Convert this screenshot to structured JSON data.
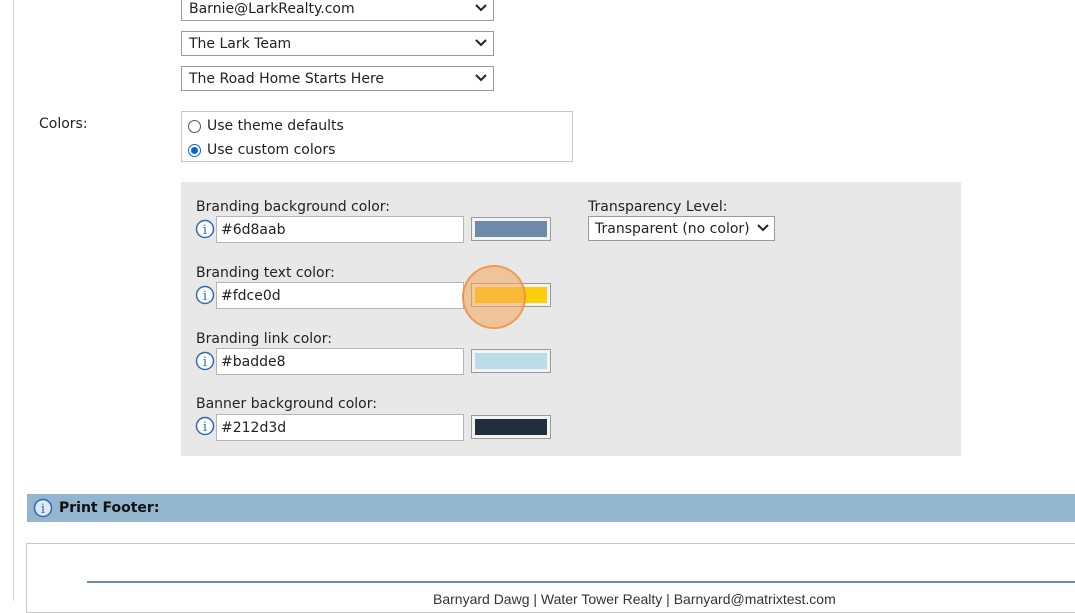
{
  "header_selects": [
    {
      "value": "Barnie@LarkRealty.com"
    },
    {
      "value": "The Lark Team"
    },
    {
      "value": "The Road Home Starts Here"
    }
  ],
  "colors": {
    "label": "Colors:",
    "options": [
      {
        "label": "Use theme defaults",
        "checked": false
      },
      {
        "label": "Use custom colors",
        "checked": true
      }
    ]
  },
  "branding": {
    "fields": [
      {
        "label": "Branding background color:",
        "value": "#6d8aab",
        "swatch": "#6d8aab"
      },
      {
        "label": "Branding text color:",
        "value": "#fdce0d",
        "swatch": "#fdce0d"
      },
      {
        "label": "Branding link color:",
        "value": "#badde8",
        "swatch": "#badde8"
      },
      {
        "label": "Banner background color:",
        "value": "#212d3d",
        "swatch": "#212d3d"
      }
    ],
    "transparency": {
      "label": "Transparency Level:",
      "value": "Transparent (no color)"
    }
  },
  "print_footer": {
    "title": "Print Footer:",
    "preview_text": "Barnyard Dawg | Water Tower Realty | Barnyard@matrixtest.com"
  },
  "icons": {
    "info": "info-circle-icon",
    "chevron": "chevron-down-icon"
  },
  "theme": {
    "accent_blue": "#0b63d6",
    "section_bar": "#93b5cd",
    "panel_bg": "#e8e8e8"
  }
}
